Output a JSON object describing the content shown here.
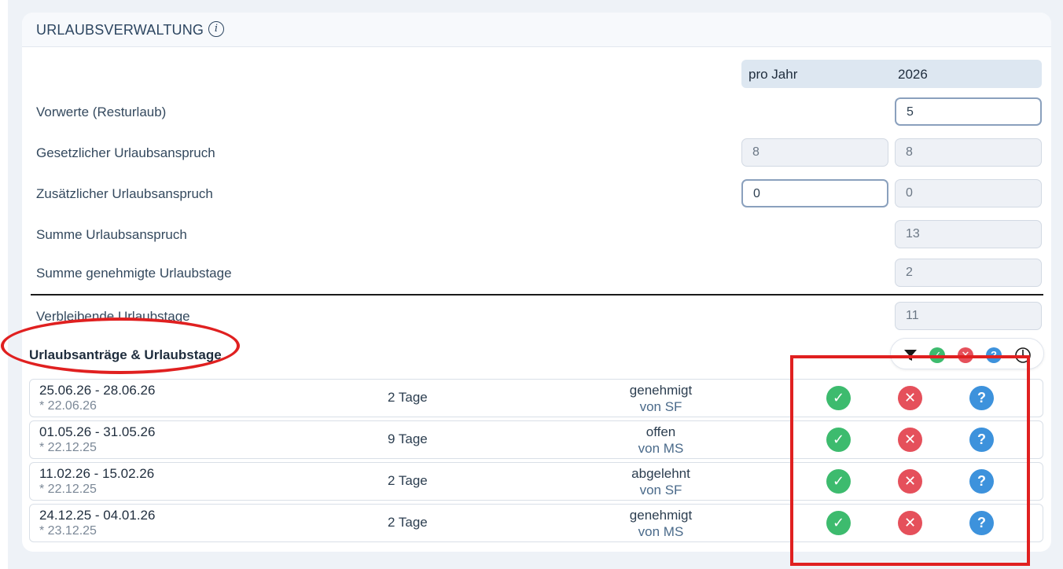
{
  "header": {
    "title": "URLAUBSVERWALTUNG",
    "info_icon": "info-icon"
  },
  "columns": {
    "per_year": "pro Jahr",
    "year": "2026"
  },
  "fields": {
    "vorwerte": {
      "label": "Vorwerte (Resturlaub)",
      "year_value": "5"
    },
    "gesetzlich": {
      "label": "Gesetzlicher Urlaubsanspruch",
      "per_year_value": "8",
      "year_value": "8"
    },
    "zusaetzlich": {
      "label": "Zusätzlicher Urlaubsanspruch",
      "per_year_value": "0",
      "year_value": "0"
    },
    "summe": {
      "label": "Summe Urlaubsanspruch",
      "year_value": "13"
    },
    "genehmigt": {
      "label": "Summe genehmigte Urlaubstage",
      "year_value": "2"
    },
    "verbleibend": {
      "label": "Verbleibende Urlaubstage",
      "year_value": "11"
    }
  },
  "requests": {
    "title": "Urlaubsanträge & Urlaubstage",
    "filter_icons": [
      "filter-icon",
      "check-icon",
      "close-icon",
      "question-icon",
      "clock-icon"
    ],
    "rows": [
      {
        "range": "25.06.26 - 28.06.26",
        "created": "* 22.06.26",
        "days": "2 Tage",
        "status": "genehmigt",
        "by": "von SF"
      },
      {
        "range": "01.05.26 - 31.05.26",
        "created": "* 22.12.25",
        "days": "9 Tage",
        "status": "offen",
        "by": "von MS"
      },
      {
        "range": "11.02.26 - 15.02.26",
        "created": "* 22.12.25",
        "days": "2 Tage",
        "status": "abgelehnt",
        "by": "von SF"
      },
      {
        "range": "24.12.25 - 04.01.26",
        "created": "* 23.12.25",
        "days": "2 Tage",
        "status": "genehmigt",
        "by": "von MS"
      }
    ]
  },
  "colors": {
    "approve": "#3dbb6e",
    "reject": "#e5505b",
    "query": "#3d92dc",
    "annotation": "#e02020"
  }
}
